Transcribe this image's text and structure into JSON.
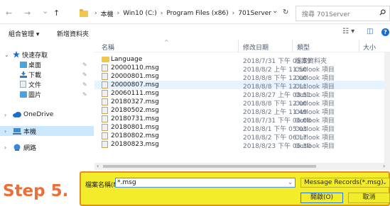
{
  "address_bar": {
    "back": "←",
    "forward": "→",
    "recent": "⌄",
    "up": "↑",
    "path": [
      "本機",
      "Win10 (C:)",
      "Program Files (x86)",
      "701Server"
    ],
    "separator": "›",
    "dropdown": "⌄",
    "refresh": "↻",
    "search_placeholder": "搜尋 701Server"
  },
  "toolbar": {
    "organize": "組合管理 ▾",
    "new_folder": "新增資料夾",
    "view": "☷ ▾",
    "preview": "◫"
  },
  "sidebar": {
    "items": [
      {
        "label": "快速存取",
        "expander": "⌄",
        "icon": "star-icon",
        "color": "#1a6fc9"
      },
      {
        "label": "桌面",
        "icon": "desktop-icon",
        "pinned": true,
        "color": "#4aa3df"
      },
      {
        "label": "下載",
        "icon": "download-icon",
        "pinned": true,
        "color": "#2a7fd0"
      },
      {
        "label": "文件",
        "icon": "documents-icon",
        "pinned": true,
        "color": "#9aa7b5"
      },
      {
        "label": "圖片",
        "icon": "pictures-icon",
        "pinned": true,
        "color": "#4aa3df"
      },
      {
        "label": "OneDrive",
        "expander": "›",
        "icon": "cloud-icon",
        "color": "#1a6fc9"
      },
      {
        "label": "本機",
        "expander": "›",
        "icon": "computer-icon",
        "selected": true,
        "color": "#3b8ad8"
      },
      {
        "label": "網路",
        "expander": "›",
        "icon": "network-icon",
        "color": "#3b8ad8"
      }
    ],
    "pin_glyph": "✎"
  },
  "file_list": {
    "columns": {
      "name": "名稱",
      "date": "修改日期",
      "type": "類型",
      "size": "大小"
    },
    "sort_indicator": "^",
    "rows": [
      {
        "name": "Language",
        "date": "2018/7/31 下午 05:59",
        "type": "檔案資料夾",
        "folder": true
      },
      {
        "name": "20000110.msg",
        "date": "2018/8/2 上午 11:50",
        "type": "Outlook 項目"
      },
      {
        "name": "20000801.msg",
        "date": "2018/8/8 下午 12:00",
        "type": "Outlook 項目"
      },
      {
        "name": "20000807.msg",
        "date": "2018/8/8 下午 12:11",
        "type": "Outlook 項目",
        "selected": true
      },
      {
        "name": "20060111.msg",
        "date": "2018/8/27 上午 08:51",
        "type": "Outlook 項目"
      },
      {
        "name": "20180327.msg",
        "date": "2018/8/8 下午 12:00",
        "type": "Outlook 項目"
      },
      {
        "name": "20180502.msg",
        "date": "2018/8/2 上午 11:49",
        "type": "Outlook 項目"
      },
      {
        "name": "20180731.msg",
        "date": "2018/7/31 下午 06:08",
        "type": "Outlook 項目"
      },
      {
        "name": "20180801.msg",
        "date": "2018/8/1 下午 05:03",
        "type": "Outlook 項目"
      },
      {
        "name": "20180802.msg",
        "date": "2018/8/2 下午 06:17",
        "type": "Outlook 項目"
      },
      {
        "name": "20180823.msg",
        "date": "2018/8/23 下午 06:30",
        "type": "Outlook 項目"
      }
    ]
  },
  "scrollbar": {
    "left_arrow": "‹",
    "right_arrow": "›"
  },
  "bottom": {
    "filename_label": "檔案名稱(N):",
    "filename_value": "*.msg",
    "filename_chevron": "⌄",
    "filetype_value": "Message Records(*.msg)",
    "filetype_chevron": "⌄",
    "open_label": "開啟(O)",
    "cancel_label": "取消"
  },
  "annotation": {
    "step": "Step 5."
  },
  "colors": {
    "highlight": "#f2ec2a",
    "highlight_border": "#e78a2a",
    "step_text": "#ec6f38",
    "selection": "#cce8ff"
  }
}
